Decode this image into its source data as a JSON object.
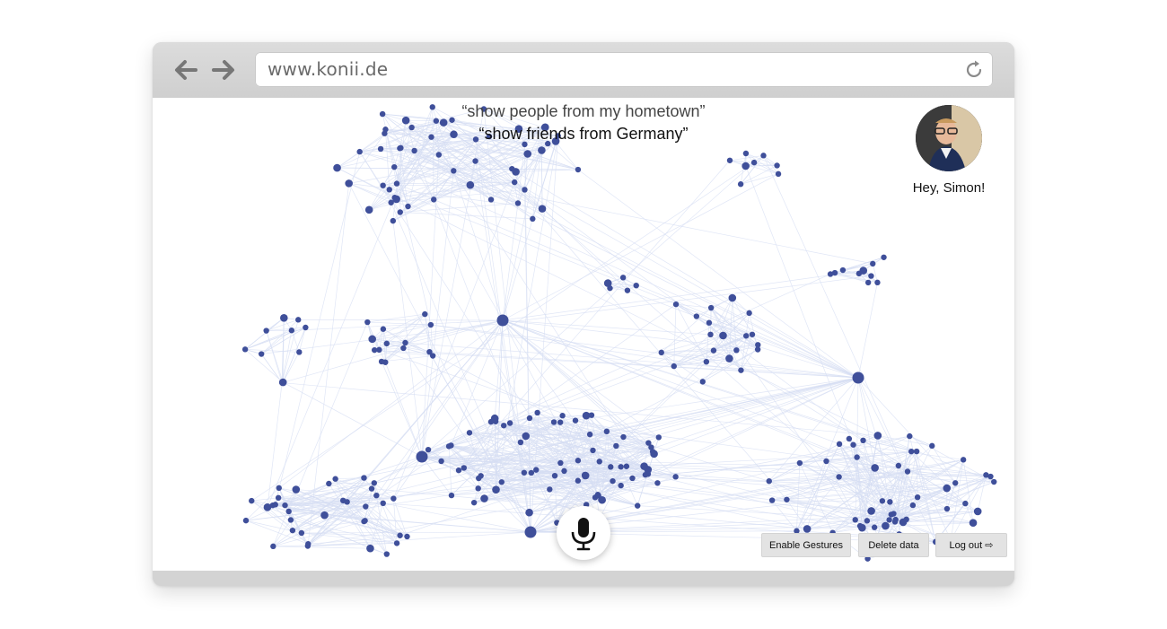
{
  "browser": {
    "url": "www.konii.de",
    "chrome_color": "#d0d0d0"
  },
  "queries": [
    "“show people from my hometown”",
    "“show friends from Germany”"
  ],
  "user": {
    "greeting": "Hey, Simon!"
  },
  "actions": {
    "enable_gestures": "Enable Gestures",
    "delete_data": "Delete data",
    "logout": "Log out"
  },
  "icons": {
    "back": "arrow-left-icon",
    "forward": "arrow-right-icon",
    "reload": "reload-icon",
    "mic": "microphone-icon",
    "logout": "logout-icon"
  },
  "colors": {
    "node": "#3f4f9a",
    "edge": "#d6ddf3"
  }
}
